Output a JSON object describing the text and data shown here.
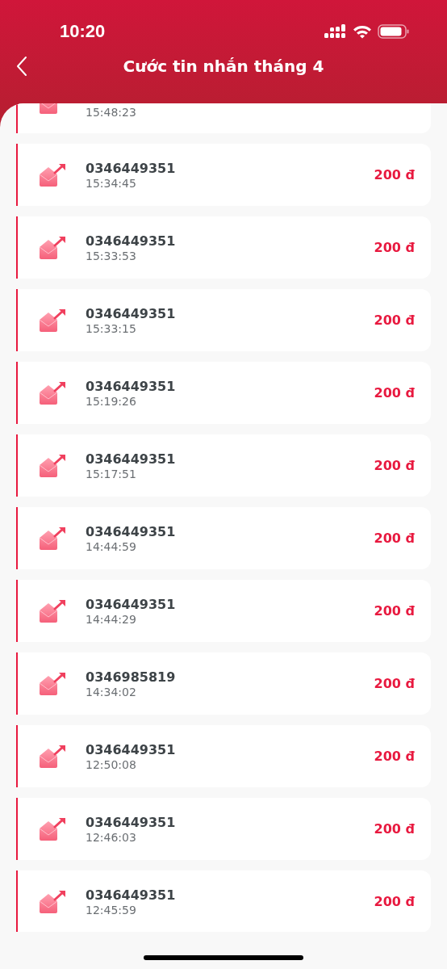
{
  "status_bar": {
    "time": "10:20"
  },
  "header": {
    "title": "Cước tin nhắn tháng 4"
  },
  "rows": [
    {
      "time": "15:48:23"
    },
    {
      "number": "0346449351",
      "time": "15:34:45",
      "amount": "200 đ"
    },
    {
      "number": "0346449351",
      "time": "15:33:53",
      "amount": "200 đ"
    },
    {
      "number": "0346449351",
      "time": "15:33:15",
      "amount": "200 đ"
    },
    {
      "number": "0346449351",
      "time": "15:19:26",
      "amount": "200 đ"
    },
    {
      "number": "0346449351",
      "time": "15:17:51",
      "amount": "200 đ"
    },
    {
      "number": "0346449351",
      "time": "14:44:59",
      "amount": "200 đ"
    },
    {
      "number": "0346449351",
      "time": "14:44:29",
      "amount": "200 đ"
    },
    {
      "number": "0346985819",
      "time": "14:34:02",
      "amount": "200 đ"
    },
    {
      "number": "0346449351",
      "time": "12:50:08",
      "amount": "200 đ"
    },
    {
      "number": "0346449351",
      "time": "12:46:03",
      "amount": "200 đ"
    },
    {
      "number": "0346449351",
      "time": "12:45:59",
      "amount": "200 đ"
    }
  ]
}
